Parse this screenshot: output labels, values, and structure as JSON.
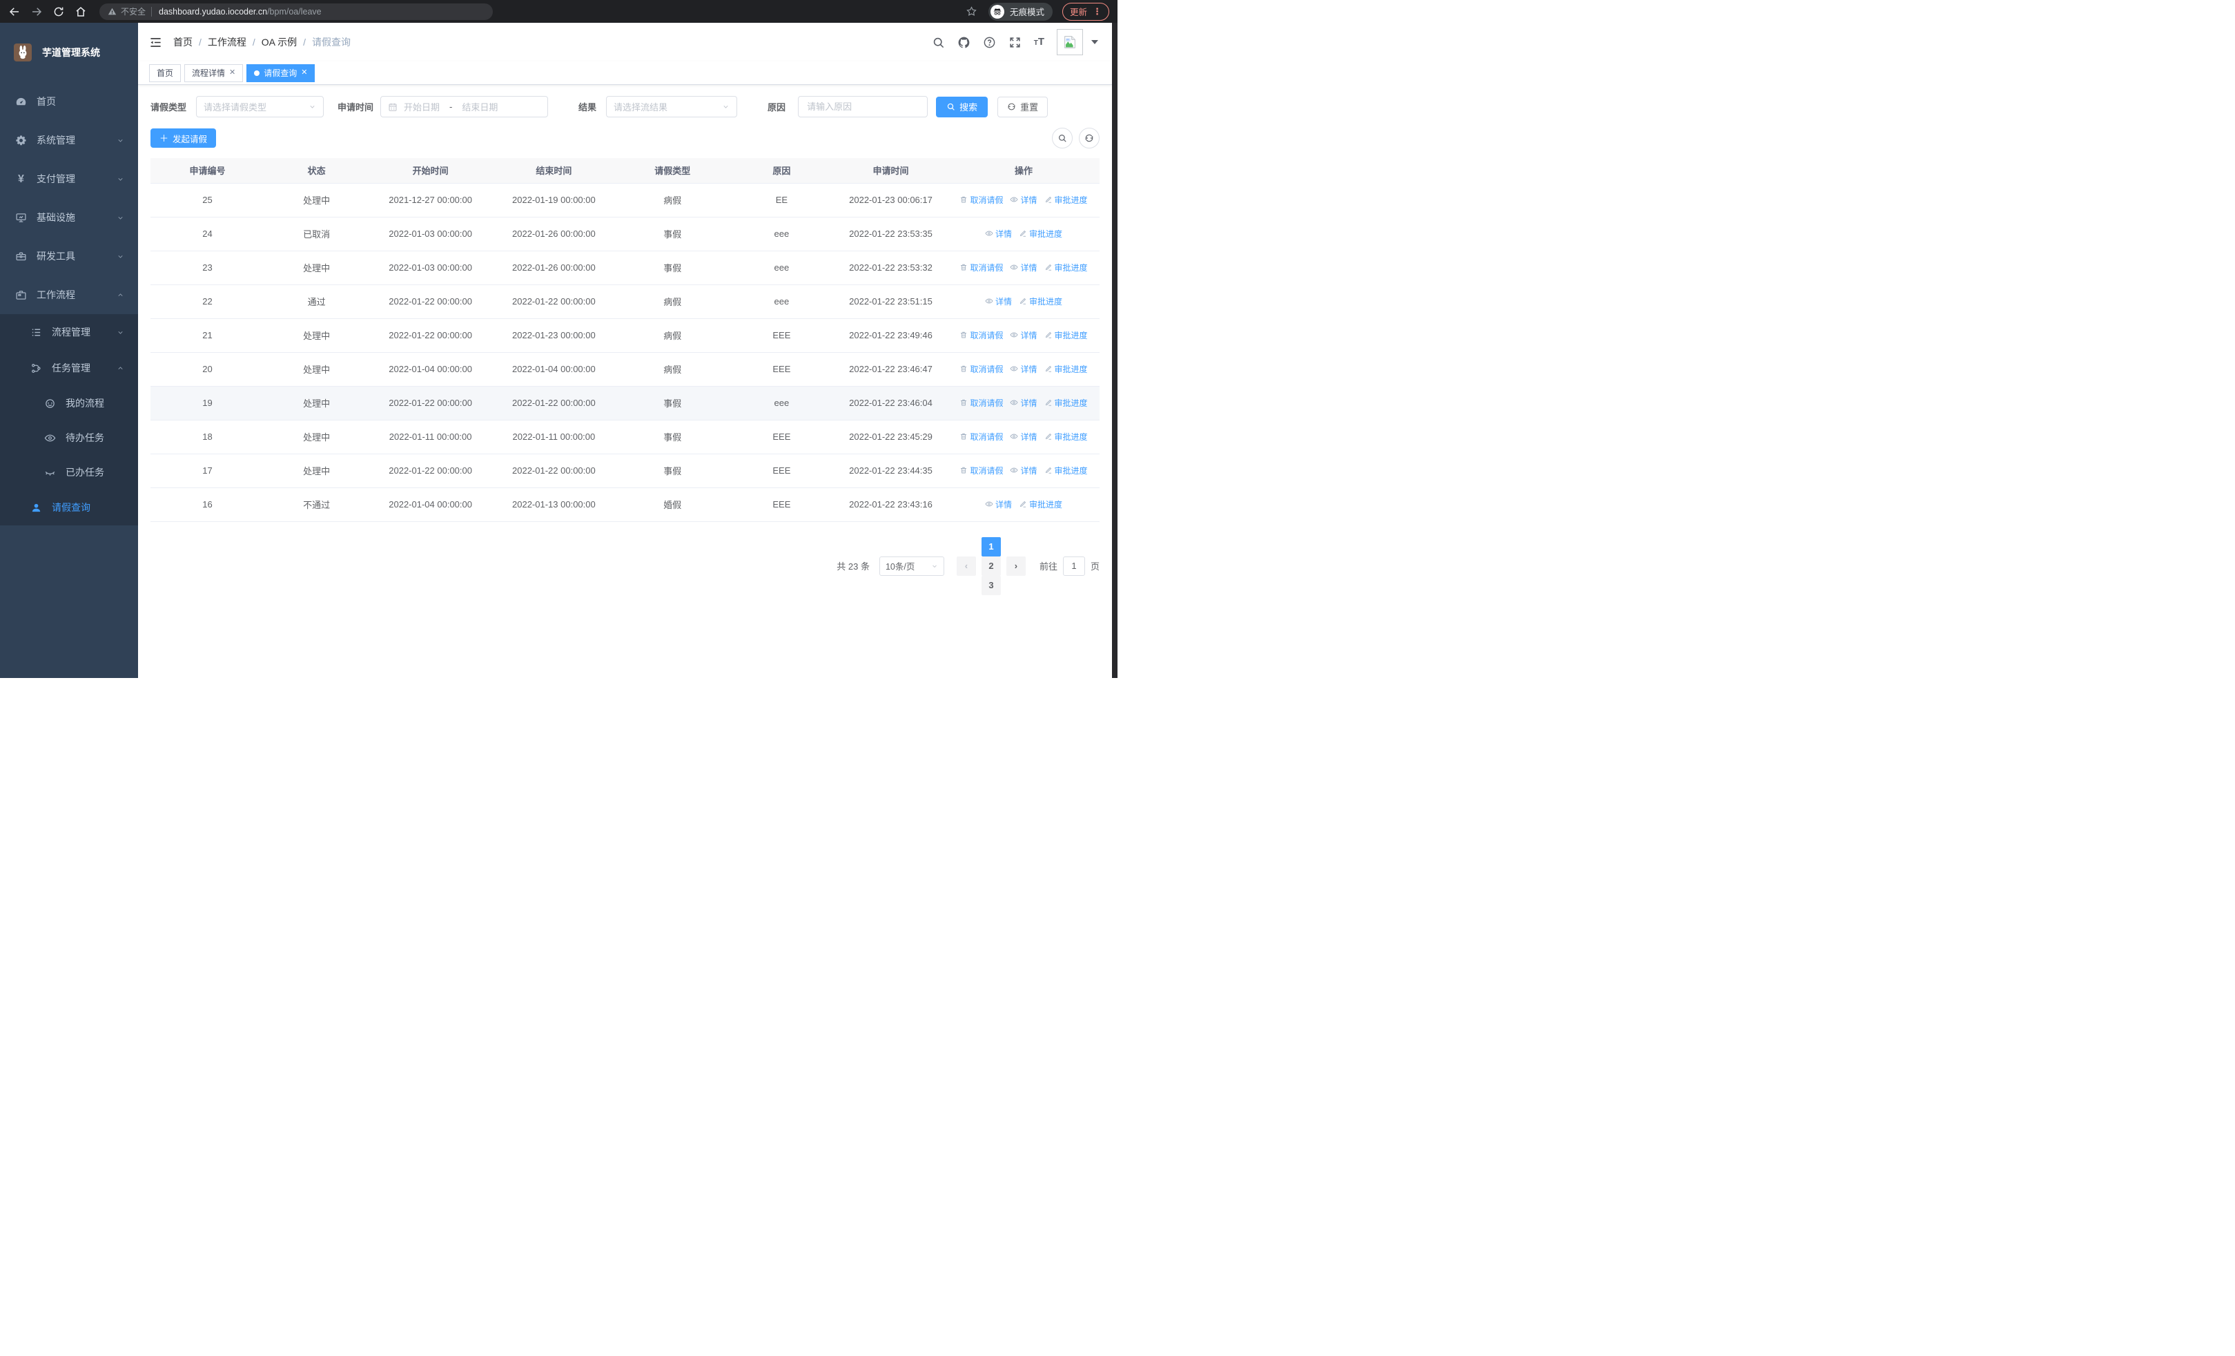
{
  "browser": {
    "security_label": "不安全",
    "url_host": "dashboard.yudao.iocoder.cn",
    "url_path": "/bpm/oa/leave",
    "incognito_label": "无痕模式",
    "update_label": "更新"
  },
  "sidebar": {
    "title": "芋道管理系统",
    "items": [
      {
        "key": "home",
        "label": "首页",
        "icon": "dashboard-icon"
      },
      {
        "key": "system",
        "label": "系统管理",
        "icon": "gear-icon",
        "chevron": "down"
      },
      {
        "key": "payment",
        "label": "支付管理",
        "icon": "yen-icon",
        "chevron": "down"
      },
      {
        "key": "infrastructure",
        "label": "基础设施",
        "icon": "monitor-icon",
        "chevron": "down"
      },
      {
        "key": "devtools",
        "label": "研发工具",
        "icon": "toolbox-icon",
        "chevron": "down"
      },
      {
        "key": "workflow",
        "label": "工作流程",
        "icon": "briefcase-icon",
        "chevron": "up",
        "children": [
          {
            "key": "process-mgmt",
            "label": "流程管理",
            "icon": "list-icon",
            "chevron": "down"
          },
          {
            "key": "task-mgmt",
            "label": "任务管理",
            "icon": "tree-icon",
            "chevron": "up",
            "children": [
              {
                "key": "my-process",
                "label": "我的流程",
                "icon": "face-icon"
              },
              {
                "key": "todo-tasks",
                "label": "待办任务",
                "icon": "eye-icon"
              },
              {
                "key": "done-tasks",
                "label": "已办任务",
                "icon": "eye-closed-icon"
              }
            ]
          },
          {
            "key": "leave-query",
            "label": "请假查询",
            "icon": "user-icon",
            "active": true
          }
        ]
      }
    ]
  },
  "header": {
    "breadcrumb": [
      "首页",
      "工作流程",
      "OA 示例",
      "请假查询"
    ]
  },
  "tabs": [
    {
      "key": "home",
      "label": "首页",
      "closable": false,
      "active": false
    },
    {
      "key": "process-detail",
      "label": "流程详情",
      "closable": true,
      "active": false
    },
    {
      "key": "leave-query",
      "label": "请假查询",
      "closable": true,
      "active": true
    }
  ],
  "filters": {
    "leave_type_label": "请假类型",
    "leave_type_placeholder": "请选择请假类型",
    "apply_time_label": "申请时间",
    "start_placeholder": "开始日期",
    "range_separator": "-",
    "end_placeholder": "结束日期",
    "result_label": "结果",
    "result_placeholder": "请选择流结果",
    "reason_label": "原因",
    "reason_placeholder": "请输入原因",
    "search_label": "搜索",
    "reset_label": "重置"
  },
  "toolbar": {
    "create_label": "发起请假"
  },
  "table": {
    "columns": [
      {
        "key": "id",
        "label": "申请编号"
      },
      {
        "key": "status",
        "label": "状态"
      },
      {
        "key": "start",
        "label": "开始时间"
      },
      {
        "key": "end",
        "label": "结束时间"
      },
      {
        "key": "type",
        "label": "请假类型"
      },
      {
        "key": "reason",
        "label": "原因"
      },
      {
        "key": "apply",
        "label": "申请时间"
      },
      {
        "key": "ops",
        "label": "操作"
      }
    ],
    "action_labels": {
      "cancel": "取消请假",
      "detail": "详情",
      "progress": "审批进度"
    },
    "rows": [
      {
        "id": "25",
        "status": "处理中",
        "start": "2021-12-27 00:00:00",
        "end": "2022-01-19 00:00:00",
        "type": "病假",
        "reason": "EE",
        "apply": "2022-01-23 00:06:17",
        "actions": [
          "cancel",
          "detail",
          "progress"
        ]
      },
      {
        "id": "24",
        "status": "已取消",
        "start": "2022-01-03 00:00:00",
        "end": "2022-01-26 00:00:00",
        "type": "事假",
        "reason": "eee",
        "apply": "2022-01-22 23:53:35",
        "actions": [
          "detail",
          "progress"
        ]
      },
      {
        "id": "23",
        "status": "处理中",
        "start": "2022-01-03 00:00:00",
        "end": "2022-01-26 00:00:00",
        "type": "事假",
        "reason": "eee",
        "apply": "2022-01-22 23:53:32",
        "actions": [
          "cancel",
          "detail",
          "progress"
        ]
      },
      {
        "id": "22",
        "status": "通过",
        "start": "2022-01-22 00:00:00",
        "end": "2022-01-22 00:00:00",
        "type": "病假",
        "reason": "eee",
        "apply": "2022-01-22 23:51:15",
        "actions": [
          "detail",
          "progress"
        ]
      },
      {
        "id": "21",
        "status": "处理中",
        "start": "2022-01-22 00:00:00",
        "end": "2022-01-23 00:00:00",
        "type": "病假",
        "reason": "EEE",
        "apply": "2022-01-22 23:49:46",
        "actions": [
          "cancel",
          "detail",
          "progress"
        ]
      },
      {
        "id": "20",
        "status": "处理中",
        "start": "2022-01-04 00:00:00",
        "end": "2022-01-04 00:00:00",
        "type": "病假",
        "reason": "EEE",
        "apply": "2022-01-22 23:46:47",
        "actions": [
          "cancel",
          "detail",
          "progress"
        ]
      },
      {
        "id": "19",
        "status": "处理中",
        "start": "2022-01-22 00:00:00",
        "end": "2022-01-22 00:00:00",
        "type": "事假",
        "reason": "eee",
        "apply": "2022-01-22 23:46:04",
        "actions": [
          "cancel",
          "detail",
          "progress"
        ],
        "hover": true
      },
      {
        "id": "18",
        "status": "处理中",
        "start": "2022-01-11 00:00:00",
        "end": "2022-01-11 00:00:00",
        "type": "事假",
        "reason": "EEE",
        "apply": "2022-01-22 23:45:29",
        "actions": [
          "cancel",
          "detail",
          "progress"
        ]
      },
      {
        "id": "17",
        "status": "处理中",
        "start": "2022-01-22 00:00:00",
        "end": "2022-01-22 00:00:00",
        "type": "事假",
        "reason": "EEE",
        "apply": "2022-01-22 23:44:35",
        "actions": [
          "cancel",
          "detail",
          "progress"
        ]
      },
      {
        "id": "16",
        "status": "不通过",
        "start": "2022-01-04 00:00:00",
        "end": "2022-01-13 00:00:00",
        "type": "婚假",
        "reason": "EEE",
        "apply": "2022-01-22 23:43:16",
        "actions": [
          "detail",
          "progress"
        ]
      }
    ]
  },
  "pagination": {
    "total_label": "共 23 条",
    "page_size_label": "10条/页",
    "pages": [
      "1",
      "2",
      "3"
    ],
    "active_page": "1",
    "goto_label": "前往",
    "goto_value": "1",
    "page_unit_label": "页"
  },
  "colors": {
    "primary": "#409eff",
    "sidebar_bg": "#304156",
    "submenu_bg": "#273445",
    "update_accent": "#f28b82"
  }
}
